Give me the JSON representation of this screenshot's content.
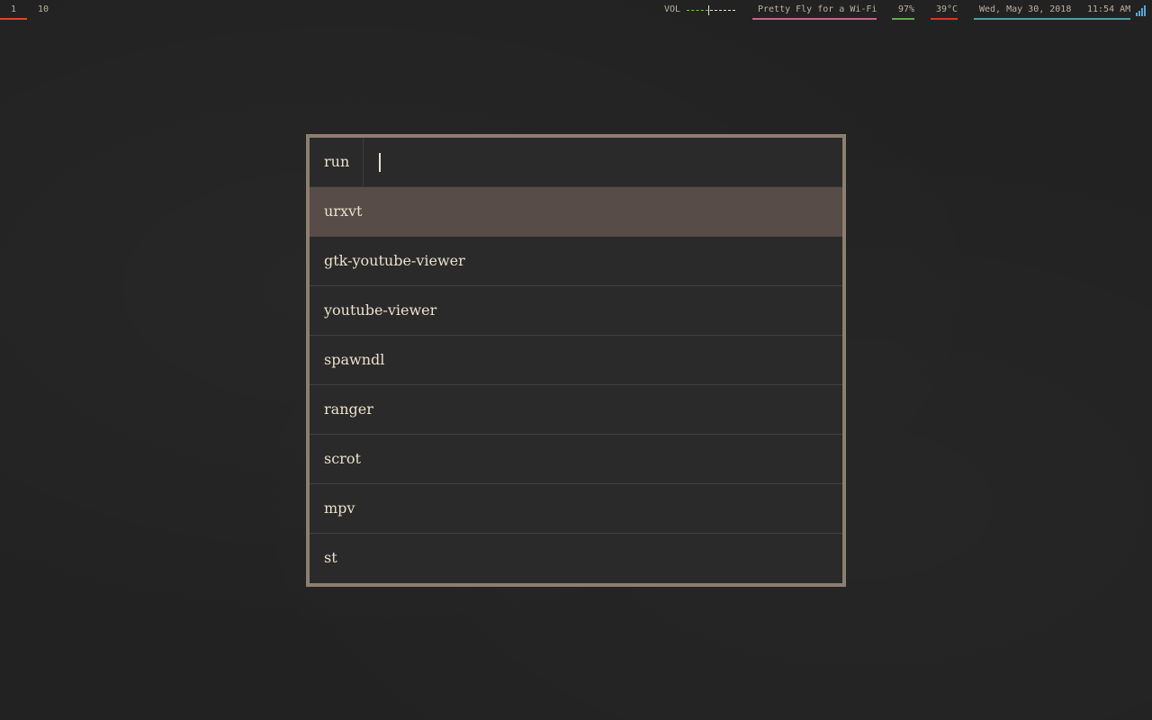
{
  "topbar": {
    "workspaces": [
      {
        "label": "1",
        "active": true,
        "color": "#d9472b"
      },
      {
        "label": "10",
        "active": false
      }
    ],
    "volume": {
      "label": "VOL",
      "level": 0.45
    },
    "wifi": {
      "ssid": "Pretty Fly for a Wi-Fi",
      "color": "#c2678a"
    },
    "battery": {
      "value": "97%",
      "color": "#6aa25c"
    },
    "temperature": {
      "value": "39°C",
      "color": "#d43535"
    },
    "clock": {
      "date": "Wed, May 30, 2018",
      "time": "11:54 AM",
      "color": "#4f9ea6"
    },
    "signal_icon": "signal-bars-icon"
  },
  "launcher": {
    "prompt": "run",
    "input_value": "",
    "selected_index": 0,
    "items": [
      "urxvt",
      "gtk-youtube-viewer",
      "youtube-viewer",
      "spawndl",
      "ranger",
      "scrot",
      "mpv",
      "st"
    ],
    "colors": {
      "border": "#8c7f70",
      "selected": "#574c47",
      "text": "#e9e1cc"
    }
  }
}
